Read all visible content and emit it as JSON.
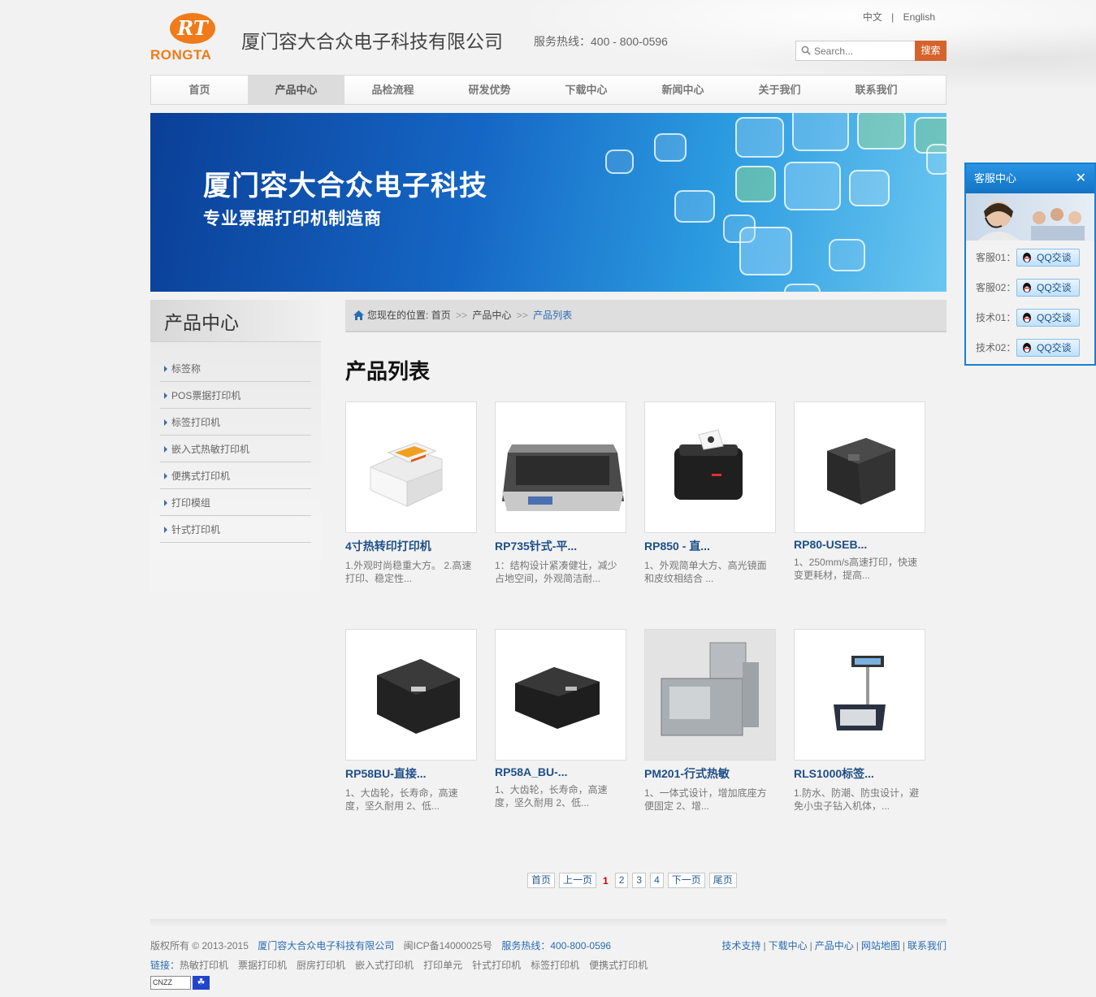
{
  "header": {
    "logo_mark": "RT",
    "logo_word": "RONGTA",
    "company_name": "厦门容大合众电子科技有限公司",
    "hotline": "服务热线：400 - 800-0596",
    "lang_cn": "中文",
    "lang_sep": "|",
    "lang_en": "English",
    "search_placeholder": "Search...",
    "search_button": "搜索"
  },
  "nav": {
    "items": [
      "首页",
      "产品中心",
      "品检流程",
      "研发优势",
      "下载中心",
      "新闻中心",
      "关于我们",
      "联系我们"
    ],
    "active_index": 1
  },
  "banner": {
    "title": "厦门容大合众电子科技",
    "subtitle": "专业票据打印机制造商"
  },
  "sidebar": {
    "title": "产品中心",
    "items": [
      "标签称",
      "POS票据打印机",
      "标签打印机",
      "嵌入式热敏打印机",
      "便携式打印机",
      "打印模组",
      "针式打印机"
    ]
  },
  "breadcrumb": {
    "prefix": "您现在的位置:",
    "home": "首页",
    "sep": ">>",
    "level1": "产品中心",
    "current": "产品列表"
  },
  "main": {
    "title": "产品列表",
    "products": [
      {
        "name": "4寸热转印打印机",
        "desc": "1.外观时尚稳重大方。 2.高速打印、稳定性..."
      },
      {
        "name": "RP735针式-平...",
        "desc": "1：结构设计紧凑健壮，减少占地空间，外观简洁耐..."
      },
      {
        "name": "RP850 - 直...",
        "desc": "1、外观简单大方、高光镜面和皮纹相结合 ..."
      },
      {
        "name": "RP80-USEB...",
        "desc": "1、250mm/s高速打印，快速变更耗材，提高..."
      },
      {
        "name": "RP58BU-直接...",
        "desc": "1、大齿轮，长寿命，高速度，坚久耐用 2、低..."
      },
      {
        "name": "RP58A_BU-...",
        "desc": "1、大齿轮，长寿命，高速度，坚久耐用 2、低..."
      },
      {
        "name": "PM201-行式热敏",
        "desc": "1、一体式设计，增加底座方便固定 2、增..."
      },
      {
        "name": "RLS1000标签...",
        "desc": "1.防水、防潮、防虫设计，避免小虫子钻入机体，..."
      }
    ]
  },
  "pager": {
    "first": "首页",
    "prev": "上一页",
    "current": "1",
    "pages": [
      "2",
      "3",
      "4"
    ],
    "next": "下一页",
    "last": "尾页"
  },
  "footer": {
    "copyright": "版权所有 © 2013-2015",
    "company": "厦门容大合众电子科技有限公司",
    "icp": "闽ICP备14000025号",
    "hotline": "服务热线：400-800-0596",
    "links": [
      "技术支持",
      "下载中心",
      "产品中心",
      "网站地图",
      "联系我们"
    ],
    "friend_label": "链接：",
    "friend_links": [
      "热敏打印机",
      "票据打印机",
      "厨房打印机",
      "嵌入式打印机",
      "打印单元",
      "针式打印机",
      "标签打印机",
      "便携式打印机"
    ],
    "badge_text": "CNZZ"
  },
  "service": {
    "title": "客服中心",
    "close": "✕",
    "rows": [
      {
        "label": "客服01：",
        "button": "QQ交谈"
      },
      {
        "label": "客服02：",
        "button": "QQ交谈"
      },
      {
        "label": "技术01：",
        "button": "QQ交谈"
      },
      {
        "label": "技术02：",
        "button": "QQ交谈"
      }
    ]
  },
  "colors": {
    "accent_orange": "#d6632b",
    "logo_orange": "#ef7b1a",
    "link_blue": "#2a6cb2",
    "product_title": "#1e4f87",
    "service_blue": "#1a7fd0"
  }
}
